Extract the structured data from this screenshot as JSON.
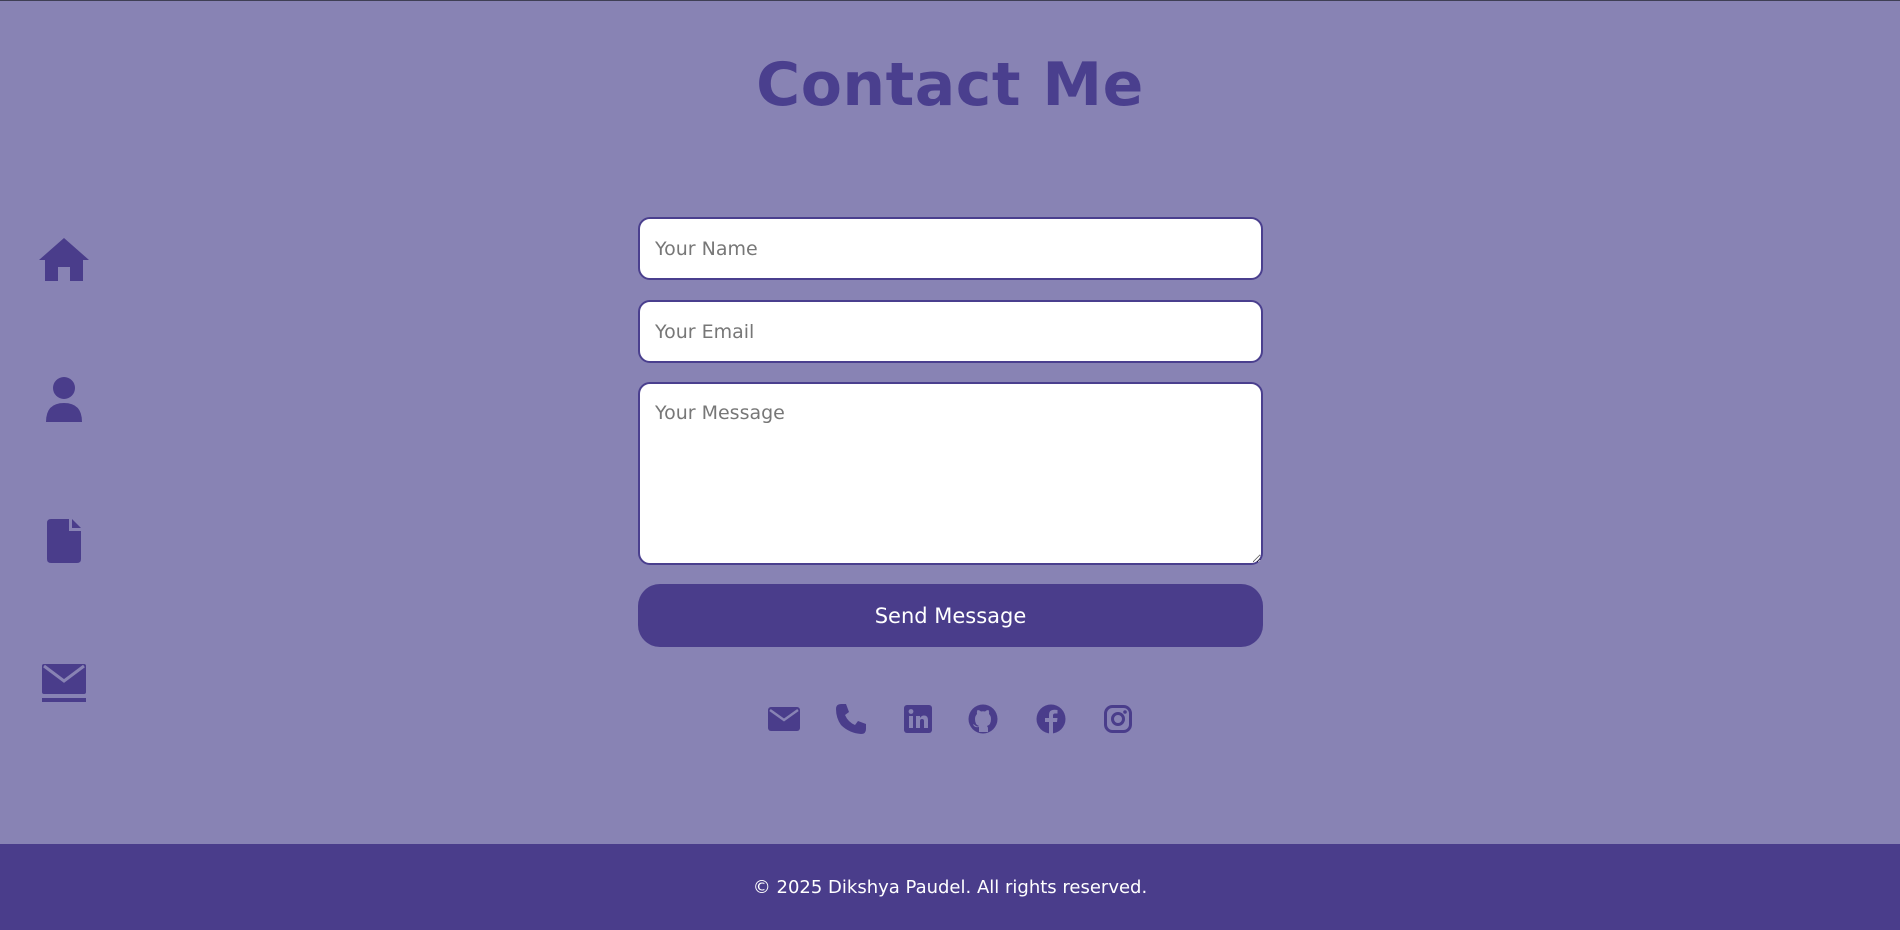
{
  "page": {
    "title": "Contact Me"
  },
  "sidebar": {
    "items": [
      {
        "icon": "home-icon"
      },
      {
        "icon": "user-icon"
      },
      {
        "icon": "file-icon"
      },
      {
        "icon": "envelope-icon"
      }
    ]
  },
  "form": {
    "name_placeholder": "Your Name",
    "name_value": "",
    "email_placeholder": "Your Email",
    "email_value": "",
    "message_placeholder": "Your Message",
    "message_value": "",
    "submit_label": "Send Message"
  },
  "socials": [
    {
      "icon": "mail-icon"
    },
    {
      "icon": "phone-icon"
    },
    {
      "icon": "linkedin-icon"
    },
    {
      "icon": "github-icon"
    },
    {
      "icon": "facebook-icon"
    },
    {
      "icon": "instagram-icon"
    }
  ],
  "footer": {
    "text": "© 2025 Dikshya Paudel. All rights reserved."
  },
  "colors": {
    "background": "#8883b4",
    "accent": "#4a3d8b",
    "title": "#4a3f8e",
    "field_background": "#ffffff",
    "footer_text": "#ffffff"
  }
}
